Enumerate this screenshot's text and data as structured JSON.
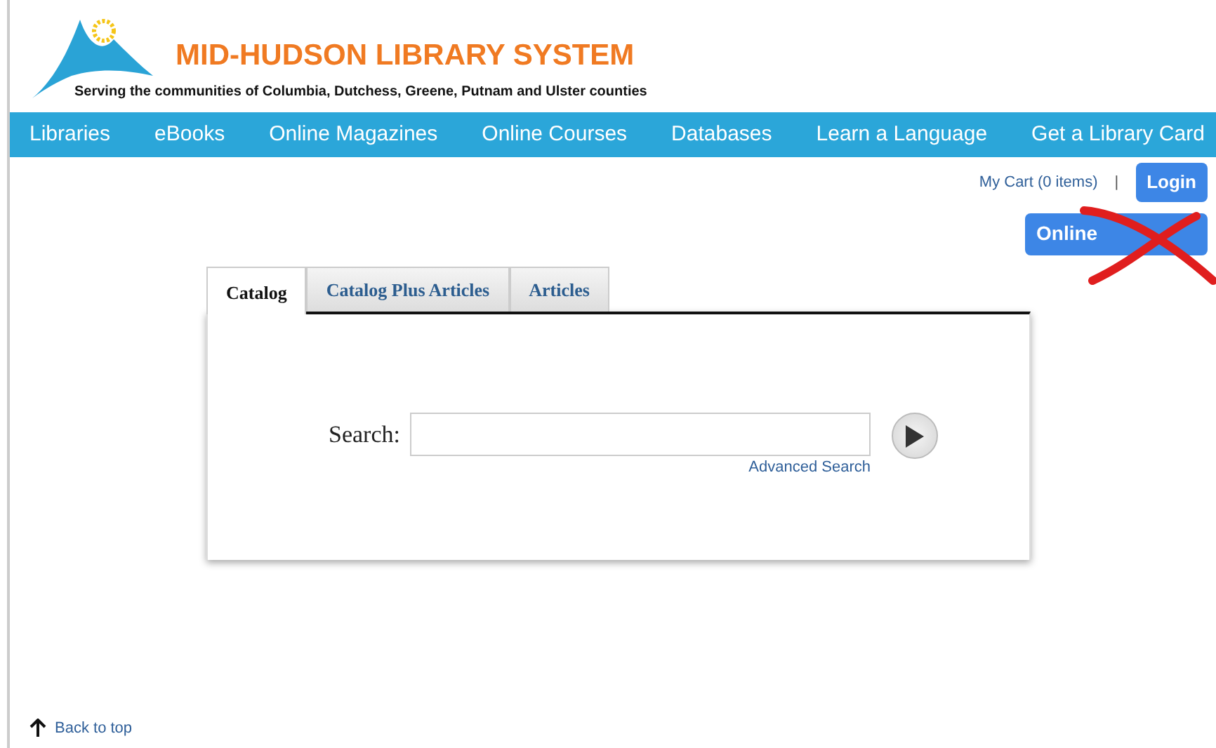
{
  "header": {
    "title": "MID-HUDSON LIBRARY SYSTEM",
    "tagline": "Serving the communities of Columbia, Dutchess, Greene, Putnam and Ulster counties"
  },
  "nav": [
    "Libraries",
    "eBooks",
    "Online Magazines",
    "Online Courses",
    "Databases",
    "Learn a Language",
    "Get a Library Card"
  ],
  "account": {
    "cart": "My Cart (0 items)",
    "separator": "|",
    "login": "Login"
  },
  "feature_button": {
    "label": "Online",
    "crossed_out": true
  },
  "tabs": [
    {
      "label": "Catalog",
      "selected": true
    },
    {
      "label": "Catalog Plus Articles",
      "selected": false
    },
    {
      "label": "Articles",
      "selected": false
    }
  ],
  "search": {
    "label": "Search:",
    "advanced_link": "Advanced Search"
  },
  "footer": {
    "back_to_top": "Back to top"
  }
}
